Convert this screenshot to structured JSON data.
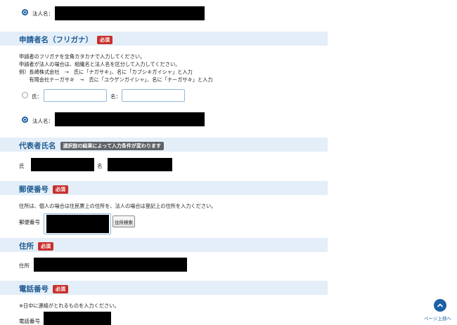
{
  "corp_name_top": {
    "label": "法人名："
  },
  "kana_section": {
    "title": "申請者名（フリガナ）",
    "badge": "必須",
    "notes": [
      "申請者のフリガナを全角カタカナで入力してください。",
      "申請者が法人の場合は、組織名と法人名を区分して入力してください。",
      "例）長崎株式会社　→　氏に「ナガサキ」、名に「カブシキガイシャ」と入力",
      "　　有限会社ナーガサキ　→　氏に「ユウゲンガイシャ」、名に「ナーガサキ」と入力"
    ],
    "radio_person_label": "氏：",
    "radio_given_label": "名：",
    "radio_corp_label": "法人名："
  },
  "rep_section": {
    "title": "代表者氏名",
    "badge": "選択肢の結果によって入力条件が変わります",
    "family_label": "氏",
    "given_label": "名"
  },
  "postal_section": {
    "title": "郵便番号",
    "badge": "必須",
    "note": "住所は、個人の場合は住民票上の住所を、法人の場合は登記上の住所を入力ください。",
    "field_label": "郵便番号",
    "search_button": "住所検索"
  },
  "address_section": {
    "title": "住所",
    "badge": "必須",
    "field_label": "住所"
  },
  "phone_section": {
    "title": "電話番号",
    "badge": "必須",
    "note": "※日中に連絡がとれるものを入力ください。",
    "field_label": "電話番号"
  },
  "page_top": {
    "label": "ページ上部へ",
    "icon": "chevron-up-icon"
  },
  "colors": {
    "accent": "#1c5fa5",
    "required": "#c9302c",
    "section_bg": "#e3eef8"
  }
}
